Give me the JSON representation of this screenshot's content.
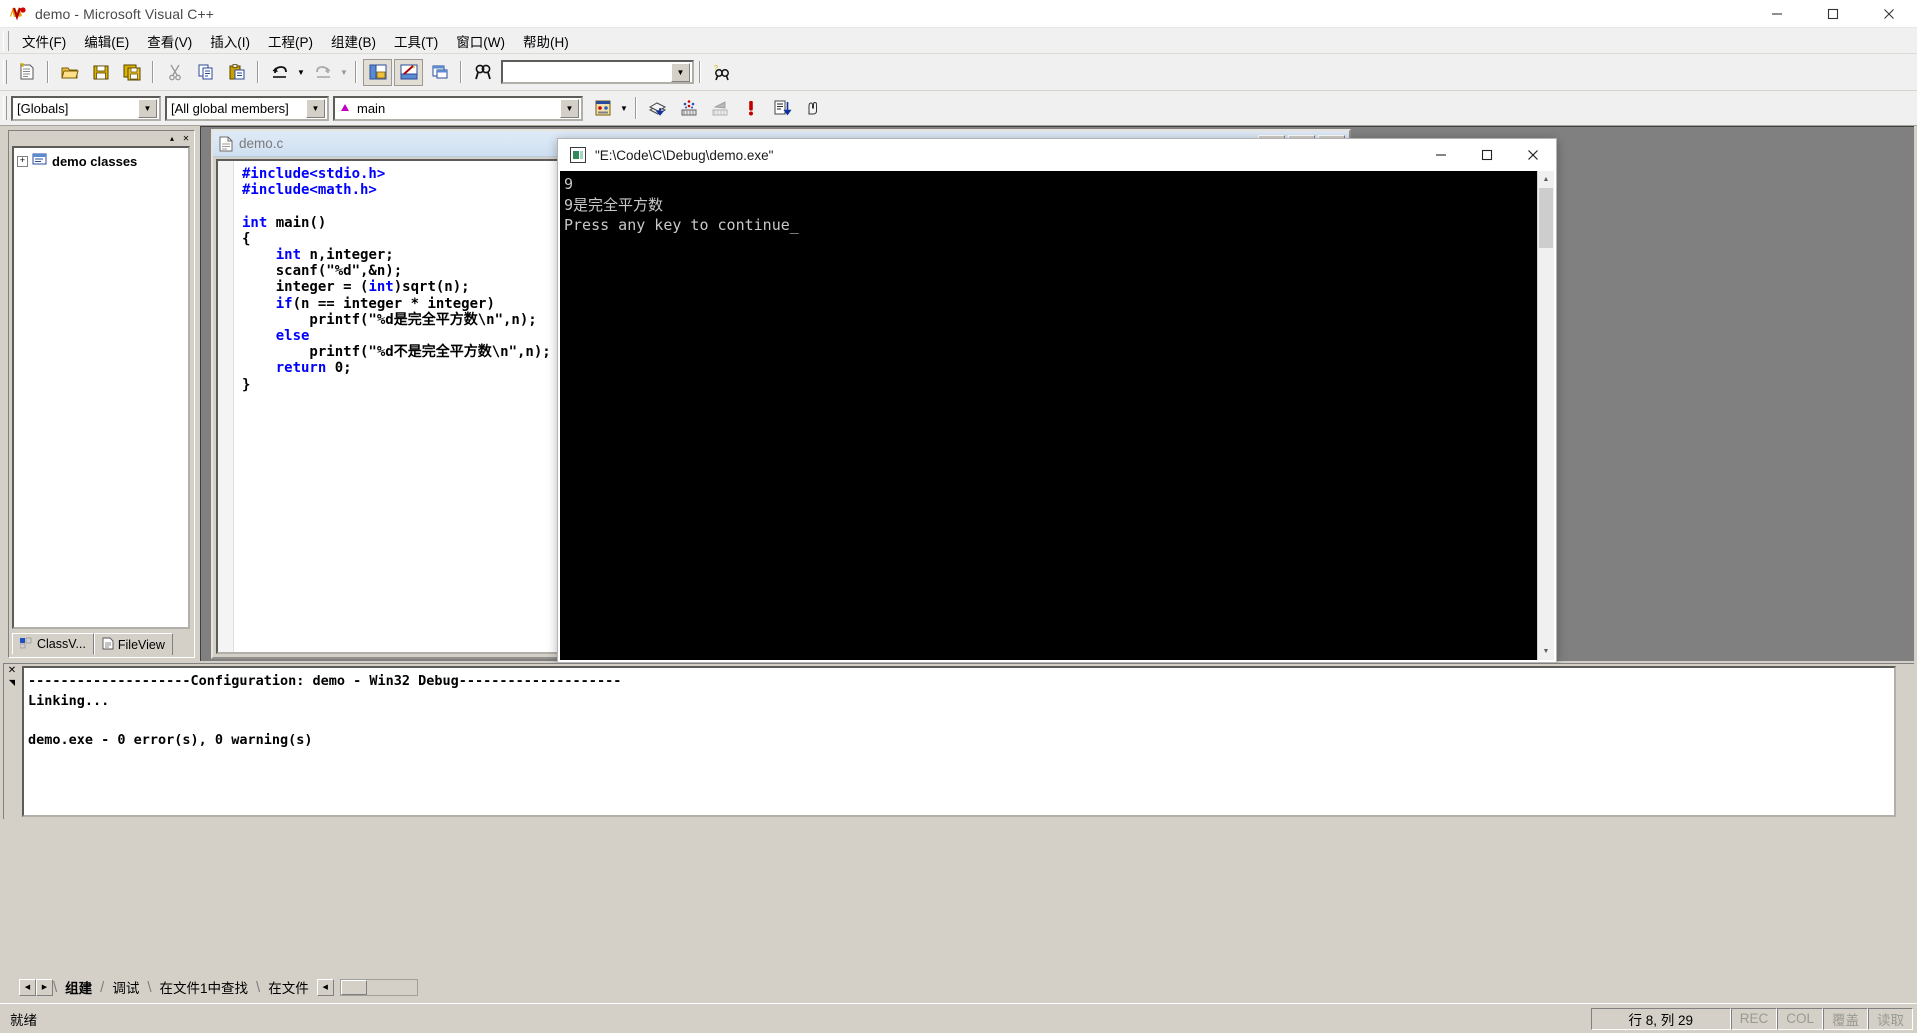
{
  "window": {
    "title": "demo - Microsoft Visual C++",
    "icon": "vcpp-logo-icon",
    "controls": {
      "minimize": "–",
      "maximize": "☐",
      "close": "✕"
    }
  },
  "menubar": {
    "items": [
      {
        "label": "文件(F)",
        "name": "menu-file"
      },
      {
        "label": "编辑(E)",
        "name": "menu-edit"
      },
      {
        "label": "查看(V)",
        "name": "menu-view"
      },
      {
        "label": "插入(I)",
        "name": "menu-insert"
      },
      {
        "label": "工程(P)",
        "name": "menu-project"
      },
      {
        "label": "组建(B)",
        "name": "menu-build"
      },
      {
        "label": "工具(T)",
        "name": "menu-tools"
      },
      {
        "label": "窗口(W)",
        "name": "menu-window"
      },
      {
        "label": "帮助(H)",
        "name": "menu-help"
      }
    ]
  },
  "toolbar_standard": {
    "buttons": [
      "new-text-file-icon",
      "open-folder-icon",
      "save-icon",
      "save-all-icon",
      "cut-icon",
      "copy-icon",
      "paste-icon",
      "undo-icon",
      "redo-icon",
      "workspace-icon",
      "output-icon",
      "window-list-icon",
      "find-in-files-icon"
    ],
    "search_value": "",
    "search_placeholder": "",
    "help_button": "find-help-icon"
  },
  "toolbar_wizard": {
    "globals_combo": "[Globals]",
    "members_combo": "[All global members]",
    "symbol_combo": "main",
    "symbol_icon": "member-function-icon",
    "buttons": [
      "compile-icon",
      "build-icon",
      "stop-build-icon",
      "execute-icon",
      "go-icon",
      "insert-breakpoint-icon"
    ]
  },
  "workspace": {
    "tree_root": "demo classes",
    "tree_expander": "+",
    "tree_icon": "class-folder-icon",
    "tabs": [
      {
        "label": "ClassV...",
        "icon": "classview-icon",
        "active": true
      },
      {
        "label": "FileView",
        "icon": "fileview-icon",
        "active": false
      }
    ]
  },
  "editor": {
    "document_title": "demo.c",
    "document_icon": "c-source-file-icon",
    "code_lines": [
      {
        "segments": [
          {
            "t": "#include<stdio.h>",
            "c": "pp"
          }
        ]
      },
      {
        "segments": [
          {
            "t": "#include<math.h>",
            "c": "pp"
          }
        ]
      },
      {
        "segments": [
          {
            "t": "",
            "c": ""
          }
        ]
      },
      {
        "segments": [
          {
            "t": "int",
            "c": "kw"
          },
          {
            "t": " main()",
            "c": ""
          }
        ]
      },
      {
        "segments": [
          {
            "t": "{",
            "c": ""
          }
        ]
      },
      {
        "segments": [
          {
            "t": "    ",
            "c": ""
          },
          {
            "t": "int",
            "c": "kw"
          },
          {
            "t": " n,integer;",
            "c": ""
          }
        ]
      },
      {
        "segments": [
          {
            "t": "    scanf(\"%d\",&n);",
            "c": ""
          }
        ]
      },
      {
        "segments": [
          {
            "t": "    integer = (",
            "c": ""
          },
          {
            "t": "int",
            "c": "kw"
          },
          {
            "t": ")sqrt(n);",
            "c": ""
          }
        ]
      },
      {
        "segments": [
          {
            "t": "    ",
            "c": ""
          },
          {
            "t": "if",
            "c": "kw"
          },
          {
            "t": "(n == integer * integer)",
            "c": ""
          }
        ]
      },
      {
        "segments": [
          {
            "t": "        printf(\"%d是完全平方数\\n\",n);",
            "c": ""
          }
        ]
      },
      {
        "segments": [
          {
            "t": "    ",
            "c": ""
          },
          {
            "t": "else",
            "c": "kw"
          }
        ]
      },
      {
        "segments": [
          {
            "t": "        printf(\"%d不是完全平方数\\n\",n);",
            "c": ""
          }
        ]
      },
      {
        "segments": [
          {
            "t": "    ",
            "c": ""
          },
          {
            "t": "return",
            "c": "kw"
          },
          {
            "t": " 0;",
            "c": ""
          }
        ]
      },
      {
        "segments": [
          {
            "t": "}",
            "c": ""
          }
        ]
      }
    ]
  },
  "console": {
    "title": "\"E:\\Code\\C\\Debug\\demo.exe\"",
    "icon": "console-app-icon",
    "output": "9\n9是完全平方数\nPress any key to continue_",
    "controls": {
      "minimize": "–",
      "maximize": "☐",
      "close": "✕"
    }
  },
  "output_pane": {
    "text": "--------------------Configuration: demo - Win32 Debug--------------------\nLinking...\n\ndemo.exe - 0 error(s), 0 warning(s)"
  },
  "output_tabs": {
    "prev": "◀",
    "next": "▶",
    "items": [
      {
        "label": "组建",
        "active": true
      },
      {
        "label": "调试",
        "active": false
      },
      {
        "label": "在文件1中查找",
        "active": false
      },
      {
        "label": "在文件",
        "active": false
      }
    ]
  },
  "statusbar": {
    "message": "就绪",
    "position": "行 8, 列 29",
    "indicators": [
      {
        "label": "REC",
        "dim": true
      },
      {
        "label": "COL",
        "dim": true
      },
      {
        "label": "覆盖",
        "dim": true
      },
      {
        "label": "读取",
        "dim": true
      }
    ]
  },
  "colors": {
    "chrome": "#d4d0c8",
    "keyword": "#0000ff",
    "console_bg": "#000000",
    "console_fg": "#c8c8c8",
    "editor_title_grad": "#cfe0f2"
  }
}
